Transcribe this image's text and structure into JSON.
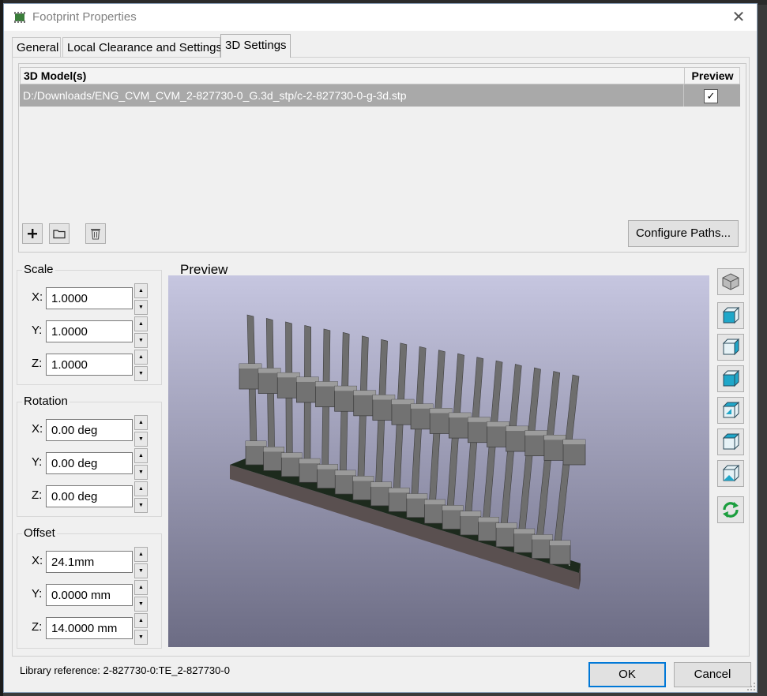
{
  "window": {
    "title": "Footprint Properties",
    "close_symbol": "✕"
  },
  "tabs": [
    {
      "label": "General"
    },
    {
      "label": "Local Clearance and Settings"
    },
    {
      "label": "3D Settings"
    }
  ],
  "models_table": {
    "col_model": "3D Model(s)",
    "col_preview": "Preview",
    "rows": [
      {
        "path": "D:/Downloads/ENG_CVM_CVM_2-827730-0_G.3d_stp/c-2-827730-0-g-3d.stp",
        "preview_checked": true
      }
    ]
  },
  "toolbar": {
    "add_icon": "plus-icon",
    "folder_icon": "folder-icon",
    "delete_icon": "trash-icon",
    "configure_paths_label": "Configure Paths..."
  },
  "scale": {
    "label": "Scale",
    "x_label": "X:",
    "x": "1.0000",
    "y_label": "Y:",
    "y": "1.0000",
    "z_label": "Z:",
    "z": "1.0000"
  },
  "rotation": {
    "label": "Rotation",
    "x_label": "X:",
    "x": "0.00 deg",
    "y_label": "Y:",
    "y": "0.00 deg",
    "z_label": "Z:",
    "z": "0.00 deg"
  },
  "offset": {
    "label": "Offset",
    "x_label": "X:",
    "x": "24.1mm",
    "y_label": "Y:",
    "y": "0.0000 mm",
    "z_label": "Z:",
    "z": "14.0000 mm"
  },
  "preview": {
    "label": "Preview",
    "background_top": "#c6c6e0",
    "background_bottom": "#6c6c84"
  },
  "view_buttons": [
    {
      "name": "view-3d-icon"
    },
    {
      "name": "view-front-icon"
    },
    {
      "name": "view-back-icon"
    },
    {
      "name": "view-left-icon"
    },
    {
      "name": "view-right-icon"
    },
    {
      "name": "view-top-icon"
    },
    {
      "name": "view-bottom-icon"
    },
    {
      "name": "reload-icon"
    }
  ],
  "footer": {
    "library_reference": "Library reference: 2-827730-0:TE_2-827730-0",
    "ok_label": "OK",
    "cancel_label": "Cancel"
  },
  "colors": {
    "accent": "#0078d7",
    "selected_row": "#a9a9a9",
    "view_icon_cyan": "#1fa7c9",
    "reload_green": "#1b9e3e"
  }
}
